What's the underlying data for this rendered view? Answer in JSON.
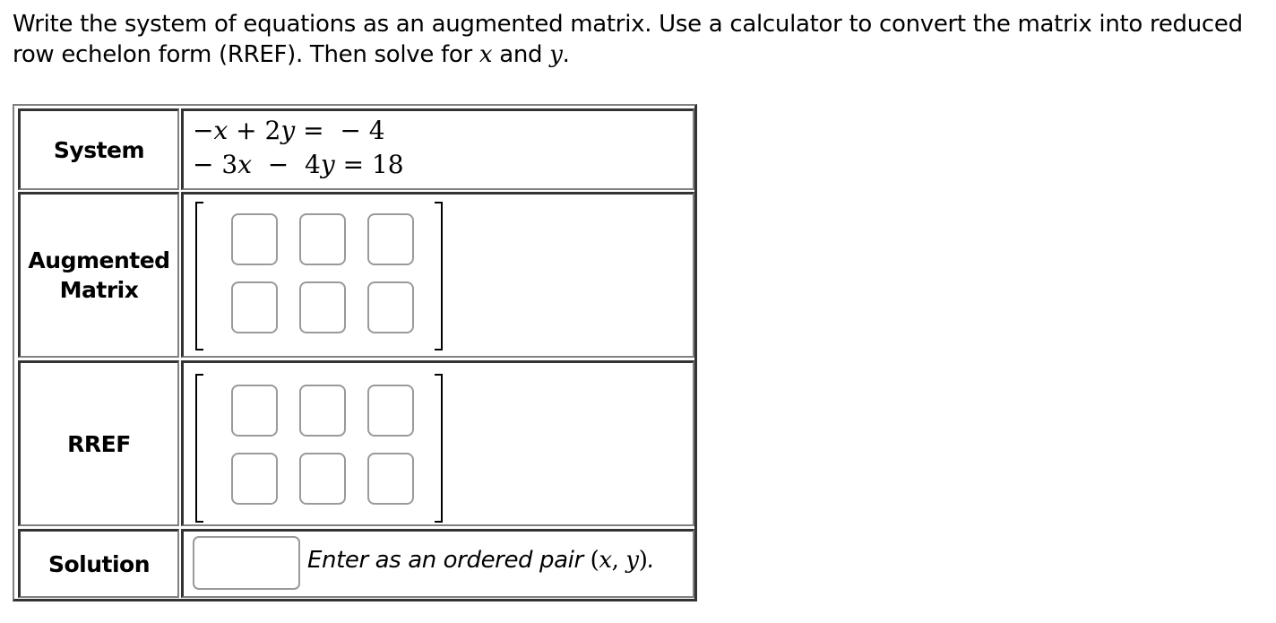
{
  "prompt": {
    "line1": "Write the system of equations as an augmented matrix. Use a calculator to convert the matrix into reduced",
    "line2_pre": "row echelon form (RREF). Then solve for ",
    "var_x": "x",
    "and": " and ",
    "var_y": "y",
    "period": "."
  },
  "rows": {
    "system": {
      "label": "System",
      "equation_1": "−x + 2y =  − 4",
      "equation_2": "− 3x  −  4y = 18",
      "equations": [
        {
          "a": -1,
          "b": 2,
          "c": -4
        },
        {
          "a": -3,
          "b": -4,
          "c": 18
        }
      ]
    },
    "augmented": {
      "label_line1": "Augmented",
      "label_line2": "Matrix",
      "rows": 2,
      "cols": 3,
      "cells": [
        [
          "",
          "",
          ""
        ],
        [
          "",
          "",
          ""
        ]
      ]
    },
    "rref": {
      "label": "RREF",
      "rows": 2,
      "cols": 3,
      "cells": [
        [
          "",
          "",
          ""
        ],
        [
          "",
          "",
          ""
        ]
      ]
    },
    "solution": {
      "label": "Solution",
      "value": "",
      "hint_text": "Enter as an ordered pair ",
      "hint_math": "(x, y)",
      "hint_math_open": "(",
      "hint_math_x": "x",
      "hint_math_comma": ", ",
      "hint_math_y": "y",
      "hint_math_close": ")",
      "hint_period": "."
    }
  }
}
